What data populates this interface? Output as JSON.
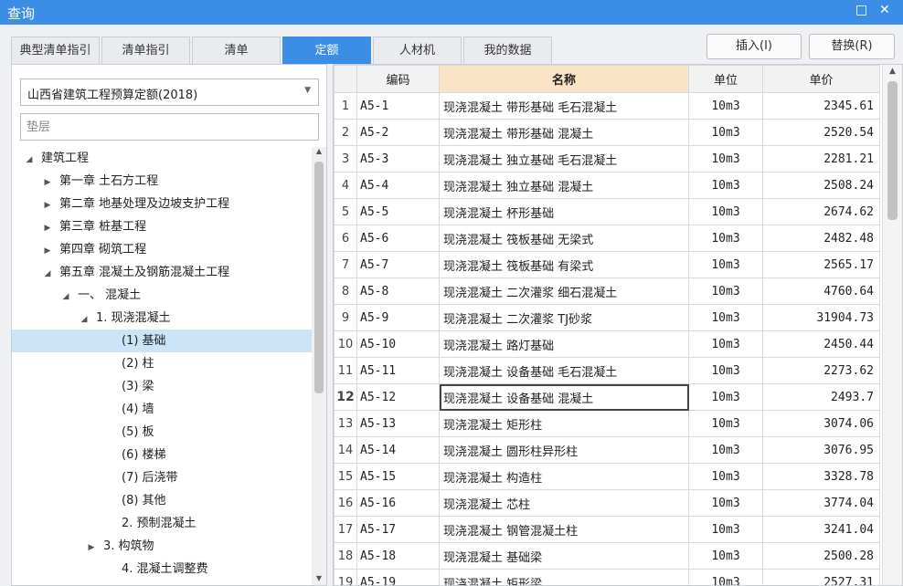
{
  "window": {
    "title": "查询",
    "restore_glyph": "□",
    "close_glyph": "✕"
  },
  "tabs": [
    "典型清单指引",
    "清单指引",
    "清单",
    "定额",
    "人材机",
    "我的数据"
  ],
  "active_tab": "定额",
  "buttons": {
    "insert": "插入(I)",
    "replace": "替换(R)"
  },
  "quota_select": {
    "value": "山西省建筑工程预算定额(2018)"
  },
  "search": {
    "placeholder": "垫层"
  },
  "tree": [
    {
      "label": "建筑工程",
      "toggle": "◢"
    },
    {
      "label": "第一章 土石方工程",
      "toggle": "▶"
    },
    {
      "label": "第二章 地基处理及边坡支护工程",
      "toggle": "▶"
    },
    {
      "label": "第三章 桩基工程",
      "toggle": "▶"
    },
    {
      "label": "第四章 砌筑工程",
      "toggle": "▶"
    },
    {
      "label": "第五章 混凝土及钢筋混凝土工程",
      "toggle": "◢"
    },
    {
      "label": "一、 混凝土",
      "toggle": "◢"
    },
    {
      "label": "1. 现浇混凝土",
      "toggle": "◢"
    },
    {
      "label": "(1) 基础",
      "toggle": ""
    },
    {
      "label": "(2) 柱",
      "toggle": ""
    },
    {
      "label": "(3) 梁",
      "toggle": ""
    },
    {
      "label": "(4) 墙",
      "toggle": ""
    },
    {
      "label": "(5) 板",
      "toggle": ""
    },
    {
      "label": "(6) 楼梯",
      "toggle": ""
    },
    {
      "label": "(7) 后浇带",
      "toggle": ""
    },
    {
      "label": "(8) 其他",
      "toggle": ""
    },
    {
      "label": "2. 预制混凝土",
      "toggle": ""
    },
    {
      "label": "3. 构筑物",
      "toggle": "▶"
    },
    {
      "label": "4. 混凝土调整费",
      "toggle": ""
    }
  ],
  "selected_tree_item": "(1) 基础",
  "table": {
    "headers": {
      "rownum": "",
      "code": "编码",
      "name": "名称",
      "unit": "单位",
      "price": "单价"
    },
    "current_row": 12,
    "rows": [
      {
        "n": "1",
        "code": "A5-1",
        "name": "现浇混凝土 带形基础 毛石混凝土",
        "unit": "10m3",
        "price": "2345.61"
      },
      {
        "n": "2",
        "code": "A5-2",
        "name": "现浇混凝土 带形基础 混凝土",
        "unit": "10m3",
        "price": "2520.54"
      },
      {
        "n": "3",
        "code": "A5-3",
        "name": "现浇混凝土 独立基础 毛石混凝土",
        "unit": "10m3",
        "price": "2281.21"
      },
      {
        "n": "4",
        "code": "A5-4",
        "name": "现浇混凝土 独立基础 混凝土",
        "unit": "10m3",
        "price": "2508.24"
      },
      {
        "n": "5",
        "code": "A5-5",
        "name": "现浇混凝土 杯形基础",
        "unit": "10m3",
        "price": "2674.62"
      },
      {
        "n": "6",
        "code": "A5-6",
        "name": "现浇混凝土 筏板基础 无梁式",
        "unit": "10m3",
        "price": "2482.48"
      },
      {
        "n": "7",
        "code": "A5-7",
        "name": "现浇混凝土 筏板基础 有梁式",
        "unit": "10m3",
        "price": "2565.17"
      },
      {
        "n": "8",
        "code": "A5-8",
        "name": "现浇混凝土 二次灌浆 细石混凝土",
        "unit": "10m3",
        "price": "4760.64"
      },
      {
        "n": "9",
        "code": "A5-9",
        "name": "现浇混凝土 二次灌浆 TJ砂浆",
        "unit": "10m3",
        "price": "31904.73"
      },
      {
        "n": "10",
        "code": "A5-10",
        "name": "现浇混凝土 路灯基础",
        "unit": "10m3",
        "price": "2450.44"
      },
      {
        "n": "11",
        "code": "A5-11",
        "name": "现浇混凝土 设备基础 毛石混凝土",
        "unit": "10m3",
        "price": "2273.62"
      },
      {
        "n": "12",
        "code": "A5-12",
        "name": "现浇混凝土 设备基础 混凝土",
        "unit": "10m3",
        "price": "2493.7"
      },
      {
        "n": "13",
        "code": "A5-13",
        "name": "现浇混凝土 矩形柱",
        "unit": "10m3",
        "price": "3074.06"
      },
      {
        "n": "14",
        "code": "A5-14",
        "name": "现浇混凝土 圆形柱异形柱",
        "unit": "10m3",
        "price": "3076.95"
      },
      {
        "n": "15",
        "code": "A5-15",
        "name": "现浇混凝土 构造柱",
        "unit": "10m3",
        "price": "3328.78"
      },
      {
        "n": "16",
        "code": "A5-16",
        "name": "现浇混凝土 芯柱",
        "unit": "10m3",
        "price": "3774.04"
      },
      {
        "n": "17",
        "code": "A5-17",
        "name": "现浇混凝土 钢管混凝土柱",
        "unit": "10m3",
        "price": "3241.04"
      },
      {
        "n": "18",
        "code": "A5-18",
        "name": "现浇混凝土 基础梁",
        "unit": "10m3",
        "price": "2500.28"
      },
      {
        "n": "19",
        "code": "A5-19",
        "name": "现浇混凝土 矩形梁",
        "unit": "10m3",
        "price": "2527.31"
      }
    ]
  },
  "colors": {
    "accent": "#3b8de6",
    "selected_row": "#cce4f7",
    "header_highlight": "#fbe3c5"
  }
}
